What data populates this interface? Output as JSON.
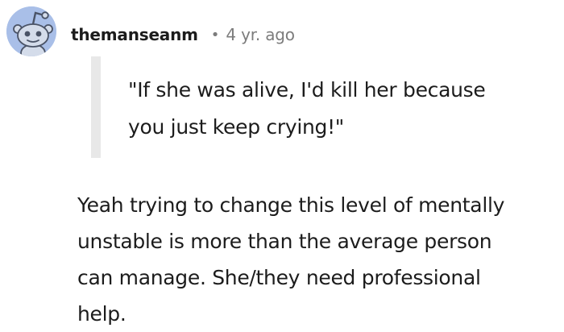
{
  "comment": {
    "username": "themanseanm",
    "separator": "•",
    "timestamp": "4 yr. ago",
    "quote_lines": [
      "\"If she was alive, I'd kill her because",
      "you just keep crying!\""
    ],
    "body_lines": [
      "Yeah trying to change this level of mentally",
      "unstable is more than the average person",
      "can manage. She/they need professional",
      "help."
    ]
  },
  "icons": {
    "avatar": "snoo-avatar-icon"
  },
  "colors": {
    "avatar_background": "#a9bfe8",
    "text": "#1c1c1c",
    "meta": "#7c7c7c",
    "quote_bar": "#e8e8e8"
  }
}
